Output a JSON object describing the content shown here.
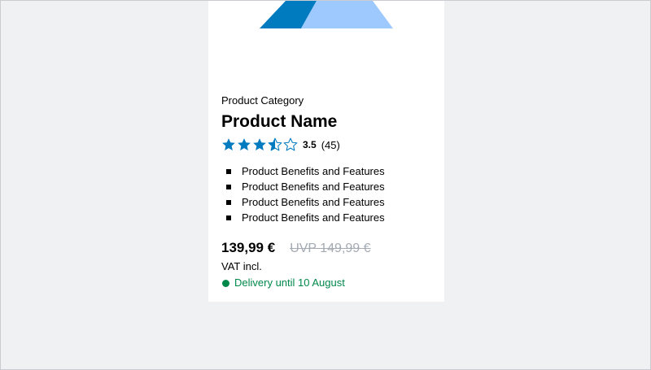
{
  "product": {
    "category": "Product Category",
    "name": "Product Name",
    "rating": {
      "value": "3.5",
      "count": "(45)",
      "stars_out_of": 5
    },
    "benefits": [
      "Product Benefits and Features",
      "Product Benefits and Features",
      "Product Benefits and Features",
      "Product Benefits and Features"
    ],
    "price": "139,99 €",
    "uvp": "UVP 149,99 €",
    "vat": "VAT incl.",
    "delivery": "Delivery until 10 August"
  },
  "colors": {
    "page_background": "#eff1f2",
    "card_background": "#ffffff",
    "star_color": "#007bc0",
    "image_dark_blue": "#007bc0",
    "image_light_blue": "#9dc9ff",
    "delivery_green": "#00884a",
    "uvp_gray": "#a4abb3"
  },
  "icons": {
    "star_full": "star-full-icon",
    "star_half": "star-half-icon",
    "star_empty": "star-empty-icon",
    "delivery_status": "status-dot-icon"
  }
}
